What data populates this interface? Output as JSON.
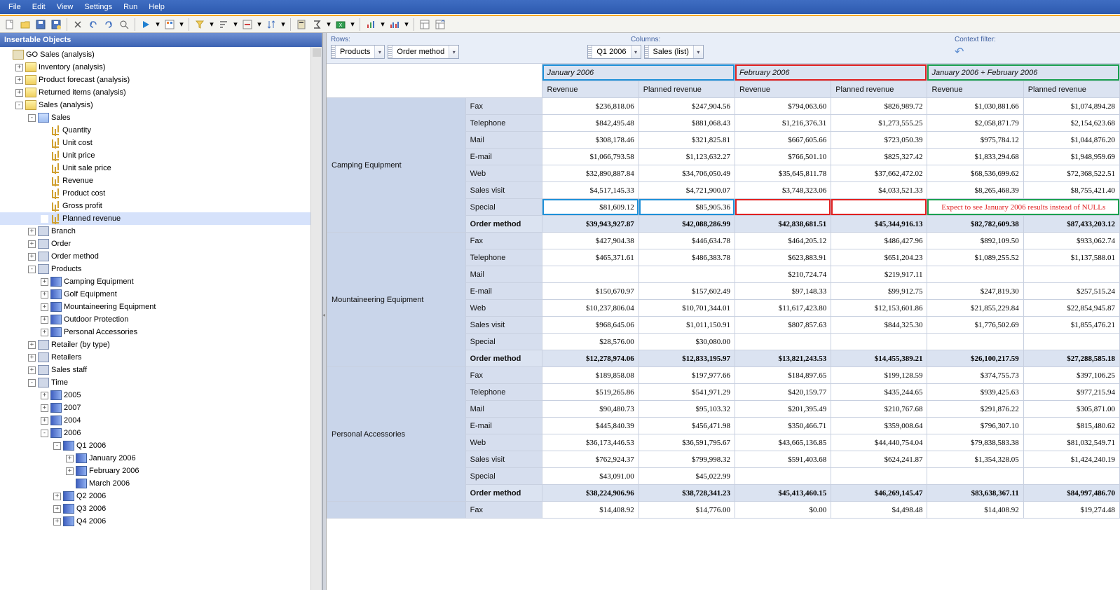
{
  "menubar": [
    "File",
    "Edit",
    "View",
    "Settings",
    "Run",
    "Help"
  ],
  "sidebar": {
    "title": "Insertable Objects",
    "tree": [
      {
        "d": 0,
        "exp": "",
        "icon": "cube",
        "label": "GO Sales (analysis)"
      },
      {
        "d": 1,
        "exp": "+",
        "icon": "folder",
        "label": "Inventory (analysis)"
      },
      {
        "d": 1,
        "exp": "+",
        "icon": "folder",
        "label": "Product forecast (analysis)"
      },
      {
        "d": 1,
        "exp": "+",
        "icon": "folder",
        "label": "Returned items (analysis)"
      },
      {
        "d": 1,
        "exp": "-",
        "icon": "folder",
        "label": "Sales (analysis)"
      },
      {
        "d": 2,
        "exp": "-",
        "icon": "folder-blue",
        "label": "Sales"
      },
      {
        "d": 3,
        "exp": "",
        "icon": "measure",
        "label": "Quantity"
      },
      {
        "d": 3,
        "exp": "",
        "icon": "measure",
        "label": "Unit cost"
      },
      {
        "d": 3,
        "exp": "",
        "icon": "measure",
        "label": "Unit price"
      },
      {
        "d": 3,
        "exp": "",
        "icon": "measure",
        "label": "Unit sale price"
      },
      {
        "d": 3,
        "exp": "",
        "icon": "measure",
        "label": "Revenue"
      },
      {
        "d": 3,
        "exp": "",
        "icon": "measure",
        "label": "Product cost"
      },
      {
        "d": 3,
        "exp": "",
        "icon": "measure",
        "label": "Gross profit"
      },
      {
        "d": 3,
        "exp": "",
        "icon": "measure",
        "label": "Planned revenue",
        "selected": true
      },
      {
        "d": 2,
        "exp": "+",
        "icon": "dim",
        "label": "Branch"
      },
      {
        "d": 2,
        "exp": "+",
        "icon": "dim",
        "label": "Order"
      },
      {
        "d": 2,
        "exp": "+",
        "icon": "dim",
        "label": "Order method"
      },
      {
        "d": 2,
        "exp": "-",
        "icon": "dim",
        "label": "Products"
      },
      {
        "d": 3,
        "exp": "+",
        "icon": "level",
        "label": "Camping Equipment"
      },
      {
        "d": 3,
        "exp": "+",
        "icon": "level",
        "label": "Golf Equipment"
      },
      {
        "d": 3,
        "exp": "+",
        "icon": "level",
        "label": "Mountaineering Equipment"
      },
      {
        "d": 3,
        "exp": "+",
        "icon": "level",
        "label": "Outdoor Protection"
      },
      {
        "d": 3,
        "exp": "+",
        "icon": "level",
        "label": "Personal Accessories"
      },
      {
        "d": 2,
        "exp": "+",
        "icon": "dim",
        "label": "Retailer (by type)"
      },
      {
        "d": 2,
        "exp": "+",
        "icon": "dim",
        "label": "Retailers"
      },
      {
        "d": 2,
        "exp": "+",
        "icon": "dim",
        "label": "Sales staff"
      },
      {
        "d": 2,
        "exp": "-",
        "icon": "dim",
        "label": "Time"
      },
      {
        "d": 3,
        "exp": "+",
        "icon": "level",
        "label": "2005"
      },
      {
        "d": 3,
        "exp": "+",
        "icon": "level",
        "label": "2007"
      },
      {
        "d": 3,
        "exp": "+",
        "icon": "level",
        "label": "2004"
      },
      {
        "d": 3,
        "exp": "-",
        "icon": "level",
        "label": "2006"
      },
      {
        "d": 4,
        "exp": "-",
        "icon": "level",
        "label": "Q1 2006"
      },
      {
        "d": 5,
        "exp": "+",
        "icon": "level",
        "label": "January 2006"
      },
      {
        "d": 5,
        "exp": "+",
        "icon": "level",
        "label": "February 2006"
      },
      {
        "d": 5,
        "exp": "",
        "icon": "level",
        "label": "March 2006"
      },
      {
        "d": 4,
        "exp": "+",
        "icon": "level",
        "label": "Q2 2006"
      },
      {
        "d": 4,
        "exp": "+",
        "icon": "level",
        "label": "Q3 2006"
      },
      {
        "d": 4,
        "exp": "+",
        "icon": "level",
        "label": "Q4 2006"
      }
    ]
  },
  "dropzones": {
    "rows_label": "Rows:",
    "columns_label": "Columns:",
    "filter_label": "Context filter:",
    "rows": [
      "Products",
      "Order method"
    ],
    "columns": [
      "Q1 2006",
      "Sales (list)"
    ]
  },
  "grid": {
    "month_headers": [
      "January 2006",
      "February 2006",
      "January 2006  +  February 2006"
    ],
    "measure_headers": [
      "Revenue",
      "Planned revenue"
    ],
    "annotation": "Expect to see January 2006 results instead of NULLs",
    "groups": [
      {
        "category": "Camping Equipment",
        "rows": [
          {
            "m": "Fax",
            "v": [
              "$236,818.06",
              "$247,904.56",
              "$794,063.60",
              "$826,989.72",
              "$1,030,881.66",
              "$1,074,894.28"
            ]
          },
          {
            "m": "Telephone",
            "v": [
              "$842,495.48",
              "$881,068.43",
              "$1,216,376.31",
              "$1,273,555.25",
              "$2,058,871.79",
              "$2,154,623.68"
            ]
          },
          {
            "m": "Mail",
            "v": [
              "$308,178.46",
              "$321,825.81",
              "$667,605.66",
              "$723,050.39",
              "$975,784.12",
              "$1,044,876.20"
            ]
          },
          {
            "m": "E-mail",
            "v": [
              "$1,066,793.58",
              "$1,123,632.27",
              "$766,501.10",
              "$825,327.42",
              "$1,833,294.68",
              "$1,948,959.69"
            ]
          },
          {
            "m": "Web",
            "v": [
              "$32,890,887.84",
              "$34,706,050.49",
              "$35,645,811.78",
              "$37,662,472.02",
              "$68,536,699.62",
              "$72,368,522.51"
            ]
          },
          {
            "m": "Sales visit",
            "v": [
              "$4,517,145.33",
              "$4,721,900.07",
              "$3,748,323.06",
              "$4,033,521.33",
              "$8,265,468.39",
              "$8,755,421.40"
            ]
          },
          {
            "m": "Special",
            "v": [
              "$81,609.12",
              "$85,905.36",
              "",
              "",
              "",
              ""
            ],
            "hl": [
              "blue",
              "blue",
              "red",
              "red",
              "green",
              "green"
            ]
          }
        ],
        "total": {
          "m": "Order method",
          "v": [
            "$39,943,927.87",
            "$42,088,286.99",
            "$42,838,681.51",
            "$45,344,916.13",
            "$82,782,609.38",
            "$87,433,203.12"
          ]
        }
      },
      {
        "category": "Mountaineering Equipment",
        "rows": [
          {
            "m": "Fax",
            "v": [
              "$427,904.38",
              "$446,634.78",
              "$464,205.12",
              "$486,427.96",
              "$892,109.50",
              "$933,062.74"
            ]
          },
          {
            "m": "Telephone",
            "v": [
              "$465,371.61",
              "$486,383.78",
              "$623,883.91",
              "$651,204.23",
              "$1,089,255.52",
              "$1,137,588.01"
            ]
          },
          {
            "m": "Mail",
            "v": [
              "",
              "",
              "$210,724.74",
              "$219,917.11",
              "",
              ""
            ]
          },
          {
            "m": "E-mail",
            "v": [
              "$150,670.97",
              "$157,602.49",
              "$97,148.33",
              "$99,912.75",
              "$247,819.30",
              "$257,515.24"
            ]
          },
          {
            "m": "Web",
            "v": [
              "$10,237,806.04",
              "$10,701,344.01",
              "$11,617,423.80",
              "$12,153,601.86",
              "$21,855,229.84",
              "$22,854,945.87"
            ]
          },
          {
            "m": "Sales visit",
            "v": [
              "$968,645.06",
              "$1,011,150.91",
              "$807,857.63",
              "$844,325.30",
              "$1,776,502.69",
              "$1,855,476.21"
            ]
          },
          {
            "m": "Special",
            "v": [
              "$28,576.00",
              "$30,080.00",
              "",
              "",
              "",
              ""
            ]
          }
        ],
        "total": {
          "m": "Order method",
          "v": [
            "$12,278,974.06",
            "$12,833,195.97",
            "$13,821,243.53",
            "$14,455,389.21",
            "$26,100,217.59",
            "$27,288,585.18"
          ]
        }
      },
      {
        "category": "Personal Accessories",
        "rows": [
          {
            "m": "Fax",
            "v": [
              "$189,858.08",
              "$197,977.66",
              "$184,897.65",
              "$199,128.59",
              "$374,755.73",
              "$397,106.25"
            ]
          },
          {
            "m": "Telephone",
            "v": [
              "$519,265.86",
              "$541,971.29",
              "$420,159.77",
              "$435,244.65",
              "$939,425.63",
              "$977,215.94"
            ]
          },
          {
            "m": "Mail",
            "v": [
              "$90,480.73",
              "$95,103.32",
              "$201,395.49",
              "$210,767.68",
              "$291,876.22",
              "$305,871.00"
            ]
          },
          {
            "m": "E-mail",
            "v": [
              "$445,840.39",
              "$456,471.98",
              "$350,466.71",
              "$359,008.64",
              "$796,307.10",
              "$815,480.62"
            ]
          },
          {
            "m": "Web",
            "v": [
              "$36,173,446.53",
              "$36,591,795.67",
              "$43,665,136.85",
              "$44,440,754.04",
              "$79,838,583.38",
              "$81,032,549.71"
            ]
          },
          {
            "m": "Sales visit",
            "v": [
              "$762,924.37",
              "$799,998.32",
              "$591,403.68",
              "$624,241.87",
              "$1,354,328.05",
              "$1,424,240.19"
            ]
          },
          {
            "m": "Special",
            "v": [
              "$43,091.00",
              "$45,022.99",
              "",
              "",
              "",
              ""
            ]
          }
        ],
        "total": {
          "m": "Order method",
          "v": [
            "$38,224,906.96",
            "$38,728,341.23",
            "$45,413,460.15",
            "$46,269,145.47",
            "$83,638,367.11",
            "$84,997,486.70"
          ]
        }
      },
      {
        "category": "",
        "rows": [
          {
            "m": "Fax",
            "v": [
              "$14,408.92",
              "$14,776.00",
              "$0.00",
              "$4,498.48",
              "$14,408.92",
              "$19,274.48"
            ]
          }
        ]
      }
    ]
  }
}
